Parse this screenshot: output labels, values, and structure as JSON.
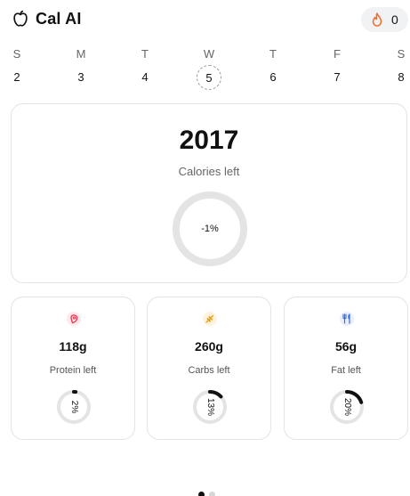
{
  "header": {
    "app_name": "Cal AI",
    "streak_count": "0",
    "logo_icon": "apple-outline-icon",
    "streak_icon": "flame-icon",
    "streak_color": "#f26b2a"
  },
  "week": {
    "days": [
      {
        "name": "S",
        "date": "2"
      },
      {
        "name": "M",
        "date": "3"
      },
      {
        "name": "T",
        "date": "4"
      },
      {
        "name": "W",
        "date": "5"
      },
      {
        "name": "T",
        "date": "6"
      },
      {
        "name": "F",
        "date": "7"
      },
      {
        "name": "S",
        "date": "8"
      }
    ],
    "selected_index": 3
  },
  "calories": {
    "value": "2017",
    "label": "Calories left",
    "percent_text": "-1%",
    "progress": 0.0
  },
  "macros": [
    {
      "key": "protein",
      "value": "118g",
      "label": "Protein left",
      "percent_text": "2%",
      "progress": 0.02,
      "icon": "steak-icon",
      "icon_color": "#e8344e",
      "icon_bg": "#fde8ec"
    },
    {
      "key": "carbs",
      "value": "260g",
      "label": "Carbs left",
      "percent_text": "13%",
      "progress": 0.13,
      "icon": "wheat-icon",
      "icon_color": "#e8a21c",
      "icon_bg": "#fdf3df"
    },
    {
      "key": "fat",
      "value": "56g",
      "label": "Fat left",
      "percent_text": "20%",
      "progress": 0.2,
      "icon": "fork-knife-icon",
      "icon_color": "#3b6fd8",
      "icon_bg": "#e7eefc"
    }
  ],
  "pager": {
    "count": 2,
    "active_index": 0
  },
  "colors": {
    "ring_track": "#e4e4e4",
    "ring_fill": "#111111"
  }
}
